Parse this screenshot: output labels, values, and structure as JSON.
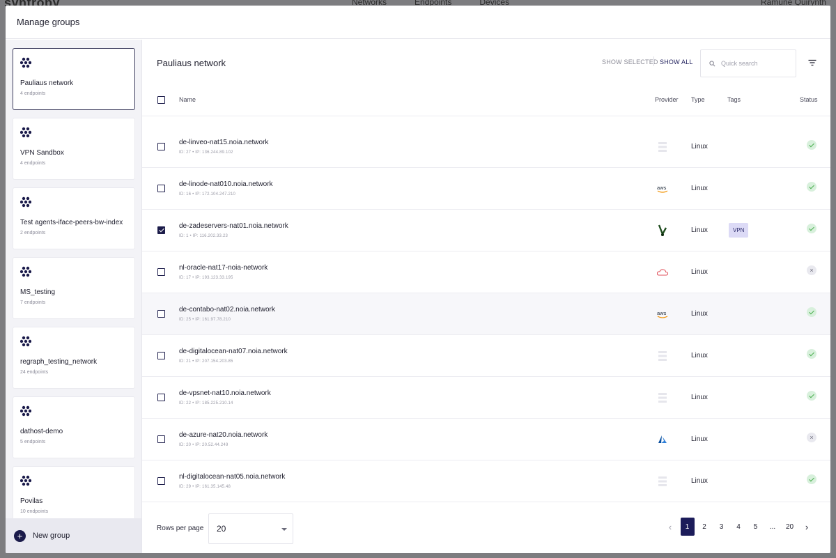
{
  "backdrop": {
    "logo": "syntropy",
    "nav": [
      "Networks",
      "Endpoints",
      "Devices"
    ],
    "user": "Ramunė Quirynth"
  },
  "modal": {
    "title": "Manage groups"
  },
  "groups": [
    {
      "name": "Pauliaus network",
      "count": "4 endpoints",
      "active": true
    },
    {
      "name": "VPN Sandbox",
      "count": "4 endpoints"
    },
    {
      "name": "Test agents-iface-peers-bw-index",
      "count": "2 endpoints"
    },
    {
      "name": "MS_testing",
      "count": "7 endpoints"
    },
    {
      "name": "regraph_testing_network",
      "count": "24 endpoints"
    },
    {
      "name": "dathost-demo",
      "count": "5 endpoints"
    },
    {
      "name": "Povilas",
      "count": "10 endpoints"
    }
  ],
  "sidebar": {
    "new_group_label": "New group"
  },
  "main": {
    "title": "Pauliaus network",
    "show_selected": "SHOW SELECTED",
    "show_all": "SHOW ALL",
    "search_placeholder": "Quick search"
  },
  "table": {
    "headers": {
      "name": "Name",
      "provider": "Provider",
      "type": "Type",
      "tags": "Tags",
      "status": "Status"
    },
    "rows": [
      {
        "name": "de-linveo-nat15.noia.network",
        "meta": "ID: 27  •  IP: 136.244.89.102",
        "provider": "generic-icon",
        "type": "Linux",
        "tag": "",
        "status": "ok",
        "checked": false
      },
      {
        "name": "de-linode-nat010.noia.network",
        "meta": "ID: 16  •  IP: 172.104.247.210",
        "provider": "aws-icon",
        "type": "Linux",
        "tag": "",
        "status": "ok",
        "checked": false
      },
      {
        "name": "de-zadeservers-nat01.noia.network",
        "meta": "ID: 1  •  IP: 116.202.33.23",
        "provider": "zadeservers-icon",
        "type": "Linux",
        "tag": "VPN",
        "status": "ok",
        "checked": true
      },
      {
        "name": "nl-oracle-nat17-noia-network",
        "meta": "ID: 17  •  IP: 193.123.33.195",
        "provider": "oracle-cloud-icon",
        "type": "Linux",
        "tag": "",
        "status": "off",
        "checked": false
      },
      {
        "name": "de-contabo-nat02.noia.network",
        "meta": "ID: 25  •  IP: 161.97.78.210",
        "provider": "aws-icon",
        "type": "Linux",
        "tag": "",
        "status": "ok",
        "checked": false
      },
      {
        "name": "de-digitalocean-nat07.noia.network",
        "meta": "ID: 21  •  IP: 207.154.203.85",
        "provider": "generic-icon",
        "type": "Linux",
        "tag": "",
        "status": "ok",
        "checked": false
      },
      {
        "name": "de-vpsnet-nat10.noia.network",
        "meta": "ID: 22  •  IP: 185.225.210.14",
        "provider": "generic-icon",
        "type": "Linux",
        "tag": "",
        "status": "ok",
        "checked": false
      },
      {
        "name": "de-azure-nat20.noia.network",
        "meta": "ID: 20  •  IP: 20.52.44.249",
        "provider": "azure-icon",
        "type": "Linux",
        "tag": "",
        "status": "off",
        "checked": false
      },
      {
        "name": "nl-digitalocean-nat05.noia.network",
        "meta": "ID: 29  •  IP: 161.35.145.48",
        "provider": "generic-icon",
        "type": "Linux",
        "tag": "",
        "status": "ok",
        "checked": false
      }
    ]
  },
  "footer": {
    "rows_per_page_label": "Rows per page",
    "rows_per_page_value": "20",
    "pages": [
      "1",
      "2",
      "3",
      "4",
      "5",
      "...",
      "20"
    ],
    "current_page": "1"
  },
  "colors": {
    "accent": "#1c1c5a",
    "ok": "#4caf50",
    "tag_bg": "#dcdaf6"
  }
}
